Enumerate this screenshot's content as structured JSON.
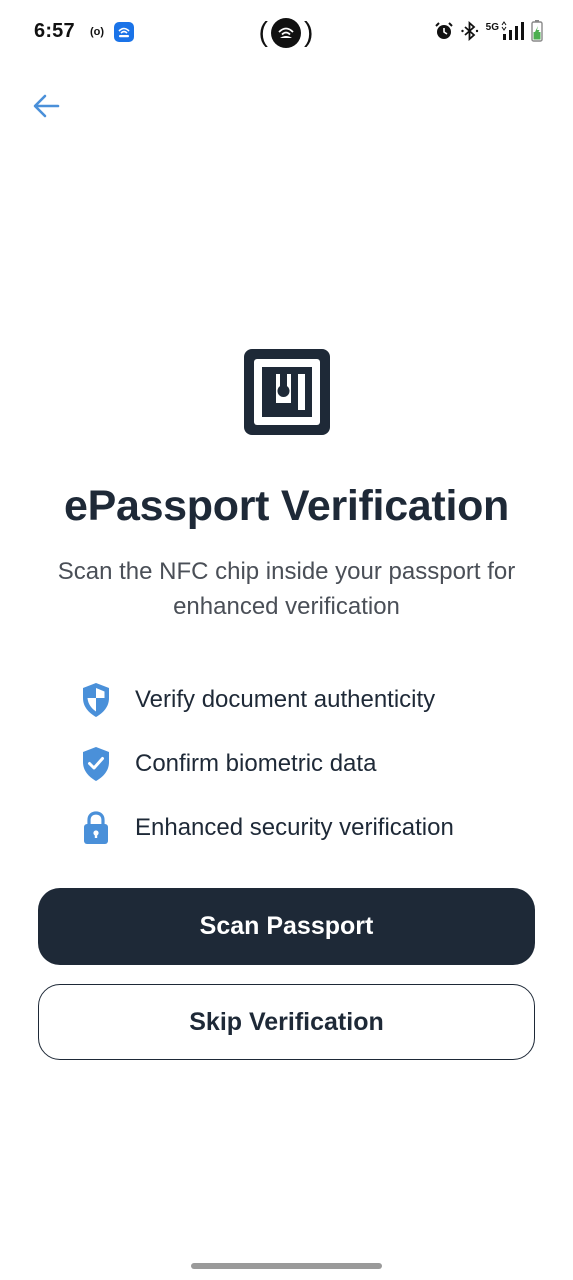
{
  "status_bar": {
    "time": "6:57",
    "radio_label": "(o)",
    "network_label": "5G",
    "icons": [
      "radio-icon",
      "app-notification-icon",
      "hotspot-icon",
      "alarm-icon",
      "bluetooth-icon",
      "signal-icon",
      "battery-icon"
    ]
  },
  "navigation": {
    "back_icon": "arrow-left-icon"
  },
  "hero": {
    "icon": "nfc-icon",
    "title": "ePassport Verification",
    "subtitle": "Scan the NFC chip inside your passport for enhanced verification"
  },
  "features": [
    {
      "icon": "shield-half-icon",
      "label": "Verify document authenticity"
    },
    {
      "icon": "shield-check-icon",
      "label": "Confirm biometric data"
    },
    {
      "icon": "lock-icon",
      "label": "Enhanced security verification"
    }
  ],
  "actions": {
    "primary_label": "Scan Passport",
    "secondary_label": "Skip Verification"
  },
  "colors": {
    "primary": "#1e2937",
    "accent": "#4a90d9",
    "background": "#ffffff"
  }
}
